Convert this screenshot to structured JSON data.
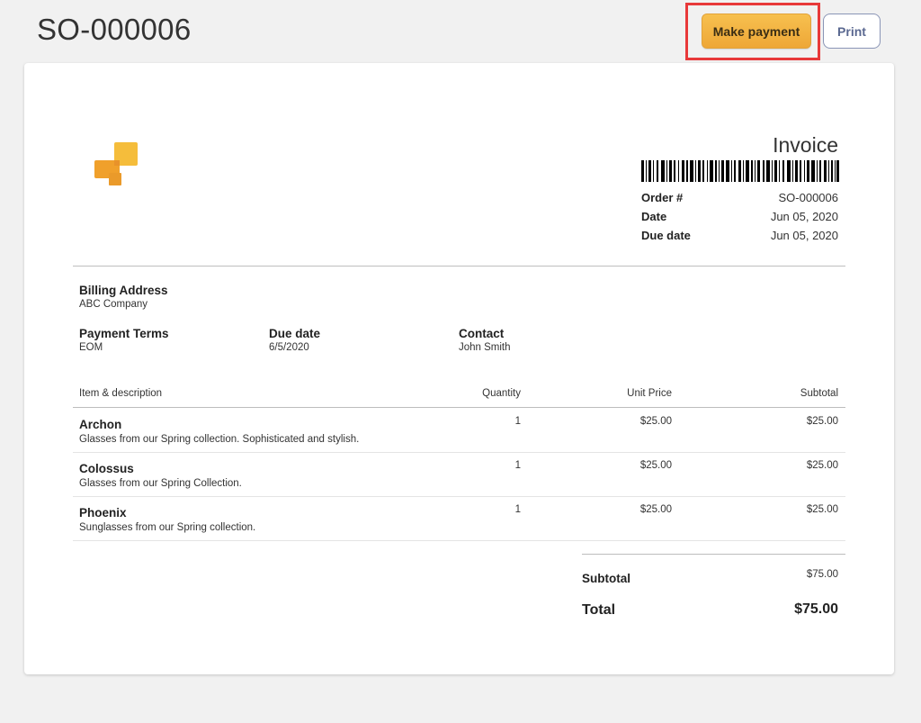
{
  "header": {
    "title": "SO-000006",
    "make_payment_label": "Make payment",
    "print_label": "Print"
  },
  "invoice": {
    "title": "Invoice",
    "meta": [
      {
        "label": "Order #",
        "value": "SO-000006"
      },
      {
        "label": "Date",
        "value": "Jun 05, 2020"
      },
      {
        "label": "Due date",
        "value": "Jun 05, 2020"
      }
    ],
    "billing_address_label": "Billing Address",
    "billing_address_value": "ABC Company",
    "payment_terms_label": "Payment Terms",
    "payment_terms_value": "EOM",
    "due_date_label": "Due date",
    "due_date_value": "6/5/2020",
    "contact_label": "Contact",
    "contact_value": "John Smith",
    "columns": {
      "item": "Item & description",
      "quantity": "Quantity",
      "unit_price": "Unit Price",
      "subtotal": "Subtotal"
    },
    "items": [
      {
        "name": "Archon",
        "description": "Glasses from our Spring collection. Sophisticated and stylish.",
        "quantity": "1",
        "unit_price": "$25.00",
        "subtotal": "$25.00"
      },
      {
        "name": "Colossus",
        "description": "Glasses from our Spring Collection.",
        "quantity": "1",
        "unit_price": "$25.00",
        "subtotal": "$25.00"
      },
      {
        "name": "Phoenix",
        "description": "Sunglasses from our Spring collection.",
        "quantity": "1",
        "unit_price": "$25.00",
        "subtotal": "$25.00"
      }
    ],
    "subtotal_label": "Subtotal",
    "subtotal_value": "$75.00",
    "total_label": "Total",
    "total_value": "$75.00"
  },
  "icons": {
    "logo": "company-logo",
    "barcode": "barcode-image"
  },
  "colors": {
    "accent": "#f0ac3c",
    "highlight": "#e8393a",
    "print_border": "#8a95b6"
  }
}
